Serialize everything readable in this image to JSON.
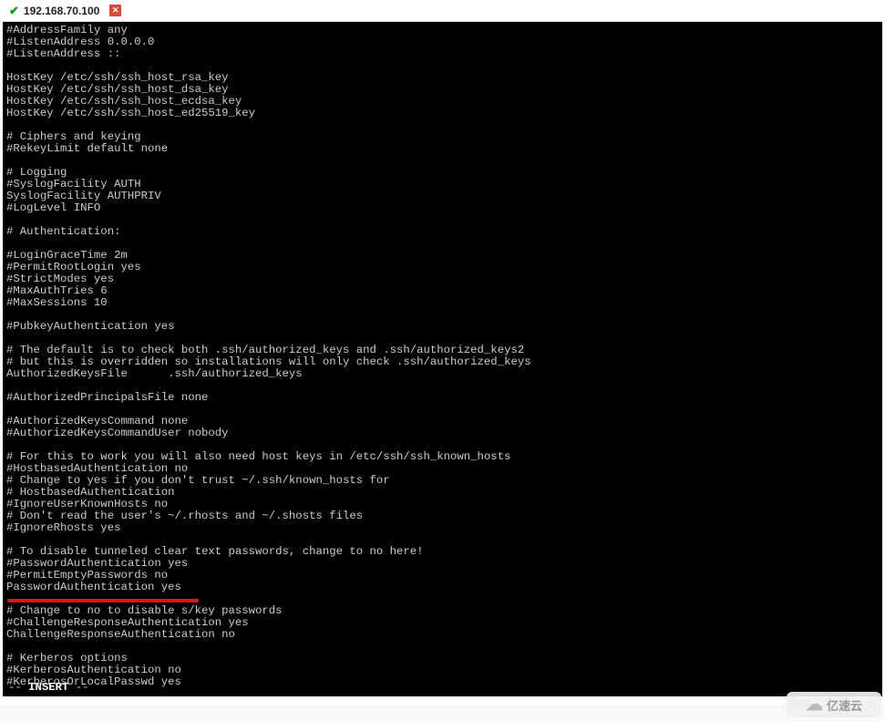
{
  "tab": {
    "ip": "192.168.70.100"
  },
  "lines": [
    "#AddressFamily any",
    "#ListenAddress 0.0.0.0",
    "#ListenAddress ::",
    "",
    "HostKey /etc/ssh/ssh_host_rsa_key",
    "HostKey /etc/ssh/ssh_host_dsa_key",
    "HostKey /etc/ssh/ssh_host_ecdsa_key",
    "HostKey /etc/ssh/ssh_host_ed25519_key",
    "",
    "# Ciphers and keying",
    "#RekeyLimit default none",
    "",
    "# Logging",
    "#SyslogFacility AUTH",
    "SyslogFacility AUTHPRIV",
    "#LogLevel INFO",
    "",
    "# Authentication:",
    "",
    "#LoginGraceTime 2m",
    "#PermitRootLogin yes",
    "#StrictModes yes",
    "#MaxAuthTries 6",
    "#MaxSessions 10",
    "",
    "#PubkeyAuthentication yes",
    "",
    "# The default is to check both .ssh/authorized_keys and .ssh/authorized_keys2",
    "# but this is overridden so installations will only check .ssh/authorized_keys",
    "AuthorizedKeysFile      .ssh/authorized_keys",
    "",
    "#AuthorizedPrincipalsFile none",
    "",
    "#AuthorizedKeysCommand none",
    "#AuthorizedKeysCommandUser nobody",
    "",
    "# For this to work you will also need host keys in /etc/ssh/ssh_known_hosts",
    "#HostbasedAuthentication no",
    "# Change to yes if you don't trust ~/.ssh/known_hosts for",
    "# HostbasedAuthentication",
    "#IgnoreUserKnownHosts no",
    "# Don't read the user's ~/.rhosts and ~/.shosts files",
    "#IgnoreRhosts yes",
    "",
    "# To disable tunneled clear text passwords, change to no here!",
    "#PasswordAuthentication yes",
    "#PermitEmptyPasswords no",
    "PasswordAuthentication yes",
    "",
    "# Change to no to disable s/key passwords",
    "#ChallengeResponseAuthentication yes",
    "ChallengeResponseAuthentication no",
    "",
    "# Kerberos options",
    "#KerberosAuthentication no",
    "#KerberosOrLocalPasswd yes"
  ],
  "status": {
    "prefix": "-- ",
    "mode": "INSERT",
    "suffix": " --"
  },
  "watermark": "亿速云"
}
